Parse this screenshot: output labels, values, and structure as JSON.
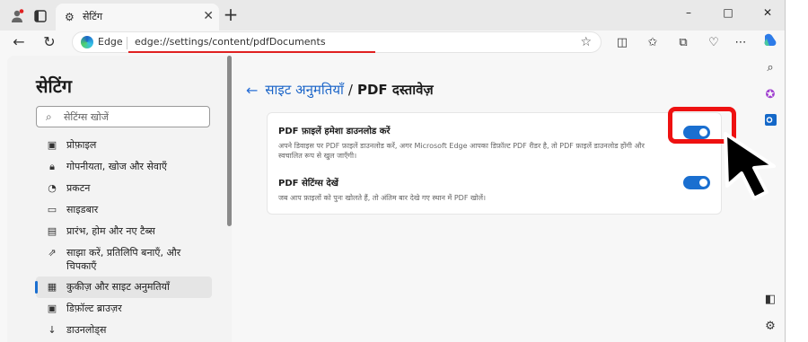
{
  "tab": {
    "title": "सेटिंग"
  },
  "window_controls": {
    "minimize": "–",
    "maximize": "□",
    "close": "✕"
  },
  "address": {
    "site_label": "Edge",
    "url": "edge://settings/content/pdfDocuments"
  },
  "sidebar": {
    "title": "सेटिंग",
    "search_placeholder": "सेटिंग्स खोजें",
    "items": [
      {
        "label": "प्रोफ़ाइल",
        "icon": "profile-icon"
      },
      {
        "label": "गोपनीयता, खोज और सेवाएँ",
        "icon": "lock-icon"
      },
      {
        "label": "प्रकटन",
        "icon": "appearance-icon"
      },
      {
        "label": "साइडबार",
        "icon": "sidebar-icon"
      },
      {
        "label": "प्रारंभ, होम और नए टैब्स",
        "icon": "home-tabs-icon"
      },
      {
        "label": "साझा करें, प्रतिलिपि बनाएँ, और चिपकाएँ",
        "icon": "share-icon"
      },
      {
        "label": "कुकीज़ और साइट अनुमतियाँ",
        "icon": "cookies-icon",
        "active": true
      },
      {
        "label": "डिफ़ॉल्ट ब्राउज़र",
        "icon": "browser-icon"
      },
      {
        "label": "डाउनलोड्स",
        "icon": "download-icon"
      }
    ]
  },
  "main": {
    "breadcrumb_link": "साइट अनुमतियाँ",
    "breadcrumb_sep": "/",
    "breadcrumb_current": "PDF दस्तावेज़",
    "settings": [
      {
        "title": "PDF फ़ाइलें हमेशा डाउनलोड करें",
        "description": "अपने डिवाइस पर PDF फ़ाइलें डाउनलोड करें, अगर Microsoft Edge आपका डिफ़ॉल्ट PDF रीडर है, तो PDF फ़ाइलें डाउनलोड होंगी और स्वचालित रूप से खुल जाएँगी।",
        "enabled": true
      },
      {
        "title": "PDF सेटिंग्स देखें",
        "description": "जब आप फ़ाइलों को पुनः खोलते हैं, तो अंतिम बार देखे गए स्थान में PDF खोलें।",
        "enabled": true
      }
    ]
  },
  "colors": {
    "accent": "#1a6fd0",
    "highlight": "#ee1111"
  }
}
